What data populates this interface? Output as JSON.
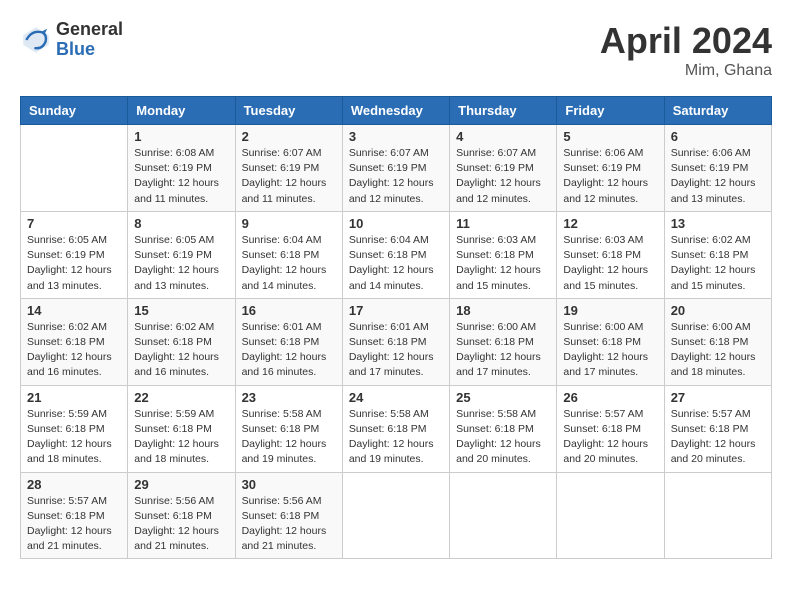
{
  "header": {
    "logo_general": "General",
    "logo_blue": "Blue",
    "month_title": "April 2024",
    "location": "Mim, Ghana"
  },
  "days_of_week": [
    "Sunday",
    "Monday",
    "Tuesday",
    "Wednesday",
    "Thursday",
    "Friday",
    "Saturday"
  ],
  "weeks": [
    [
      {
        "num": "",
        "info": ""
      },
      {
        "num": "1",
        "info": "Sunrise: 6:08 AM\nSunset: 6:19 PM\nDaylight: 12 hours\nand 11 minutes."
      },
      {
        "num": "2",
        "info": "Sunrise: 6:07 AM\nSunset: 6:19 PM\nDaylight: 12 hours\nand 11 minutes."
      },
      {
        "num": "3",
        "info": "Sunrise: 6:07 AM\nSunset: 6:19 PM\nDaylight: 12 hours\nand 12 minutes."
      },
      {
        "num": "4",
        "info": "Sunrise: 6:07 AM\nSunset: 6:19 PM\nDaylight: 12 hours\nand 12 minutes."
      },
      {
        "num": "5",
        "info": "Sunrise: 6:06 AM\nSunset: 6:19 PM\nDaylight: 12 hours\nand 12 minutes."
      },
      {
        "num": "6",
        "info": "Sunrise: 6:06 AM\nSunset: 6:19 PM\nDaylight: 12 hours\nand 13 minutes."
      }
    ],
    [
      {
        "num": "7",
        "info": "Sunrise: 6:05 AM\nSunset: 6:19 PM\nDaylight: 12 hours\nand 13 minutes."
      },
      {
        "num": "8",
        "info": "Sunrise: 6:05 AM\nSunset: 6:19 PM\nDaylight: 12 hours\nand 13 minutes."
      },
      {
        "num": "9",
        "info": "Sunrise: 6:04 AM\nSunset: 6:18 PM\nDaylight: 12 hours\nand 14 minutes."
      },
      {
        "num": "10",
        "info": "Sunrise: 6:04 AM\nSunset: 6:18 PM\nDaylight: 12 hours\nand 14 minutes."
      },
      {
        "num": "11",
        "info": "Sunrise: 6:03 AM\nSunset: 6:18 PM\nDaylight: 12 hours\nand 15 minutes."
      },
      {
        "num": "12",
        "info": "Sunrise: 6:03 AM\nSunset: 6:18 PM\nDaylight: 12 hours\nand 15 minutes."
      },
      {
        "num": "13",
        "info": "Sunrise: 6:02 AM\nSunset: 6:18 PM\nDaylight: 12 hours\nand 15 minutes."
      }
    ],
    [
      {
        "num": "14",
        "info": "Sunrise: 6:02 AM\nSunset: 6:18 PM\nDaylight: 12 hours\nand 16 minutes."
      },
      {
        "num": "15",
        "info": "Sunrise: 6:02 AM\nSunset: 6:18 PM\nDaylight: 12 hours\nand 16 minutes."
      },
      {
        "num": "16",
        "info": "Sunrise: 6:01 AM\nSunset: 6:18 PM\nDaylight: 12 hours\nand 16 minutes."
      },
      {
        "num": "17",
        "info": "Sunrise: 6:01 AM\nSunset: 6:18 PM\nDaylight: 12 hours\nand 17 minutes."
      },
      {
        "num": "18",
        "info": "Sunrise: 6:00 AM\nSunset: 6:18 PM\nDaylight: 12 hours\nand 17 minutes."
      },
      {
        "num": "19",
        "info": "Sunrise: 6:00 AM\nSunset: 6:18 PM\nDaylight: 12 hours\nand 17 minutes."
      },
      {
        "num": "20",
        "info": "Sunrise: 6:00 AM\nSunset: 6:18 PM\nDaylight: 12 hours\nand 18 minutes."
      }
    ],
    [
      {
        "num": "21",
        "info": "Sunrise: 5:59 AM\nSunset: 6:18 PM\nDaylight: 12 hours\nand 18 minutes."
      },
      {
        "num": "22",
        "info": "Sunrise: 5:59 AM\nSunset: 6:18 PM\nDaylight: 12 hours\nand 18 minutes."
      },
      {
        "num": "23",
        "info": "Sunrise: 5:58 AM\nSunset: 6:18 PM\nDaylight: 12 hours\nand 19 minutes."
      },
      {
        "num": "24",
        "info": "Sunrise: 5:58 AM\nSunset: 6:18 PM\nDaylight: 12 hours\nand 19 minutes."
      },
      {
        "num": "25",
        "info": "Sunrise: 5:58 AM\nSunset: 6:18 PM\nDaylight: 12 hours\nand 20 minutes."
      },
      {
        "num": "26",
        "info": "Sunrise: 5:57 AM\nSunset: 6:18 PM\nDaylight: 12 hours\nand 20 minutes."
      },
      {
        "num": "27",
        "info": "Sunrise: 5:57 AM\nSunset: 6:18 PM\nDaylight: 12 hours\nand 20 minutes."
      }
    ],
    [
      {
        "num": "28",
        "info": "Sunrise: 5:57 AM\nSunset: 6:18 PM\nDaylight: 12 hours\nand 21 minutes."
      },
      {
        "num": "29",
        "info": "Sunrise: 5:56 AM\nSunset: 6:18 PM\nDaylight: 12 hours\nand 21 minutes."
      },
      {
        "num": "30",
        "info": "Sunrise: 5:56 AM\nSunset: 6:18 PM\nDaylight: 12 hours\nand 21 minutes."
      },
      {
        "num": "",
        "info": ""
      },
      {
        "num": "",
        "info": ""
      },
      {
        "num": "",
        "info": ""
      },
      {
        "num": "",
        "info": ""
      }
    ]
  ]
}
